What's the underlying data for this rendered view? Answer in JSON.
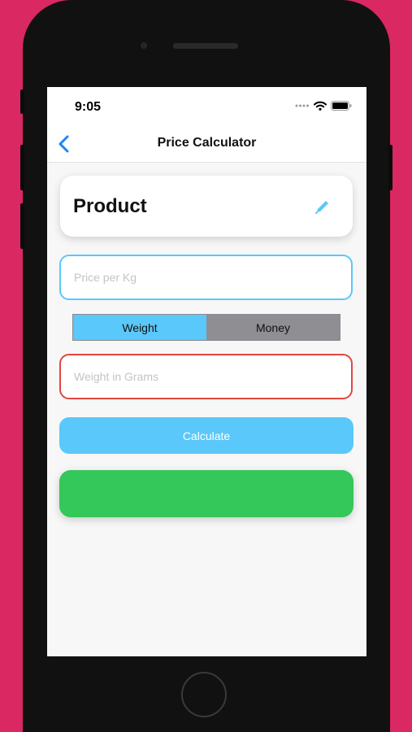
{
  "status_bar": {
    "time": "9:05"
  },
  "nav": {
    "title": "Price Calculator"
  },
  "product_card": {
    "title": "Product"
  },
  "price_field": {
    "value": "",
    "placeholder": "Price per Kg"
  },
  "mode_toggle": {
    "options": [
      "Weight",
      "Money"
    ],
    "selected": "Weight"
  },
  "weight_field": {
    "value": "",
    "placeholder": "Weight in Grams"
  },
  "calculate_button": {
    "label": "Calculate"
  },
  "result": {
    "text": ""
  },
  "colors": {
    "background": "#d92862",
    "accent_blue": "#5ac8fa",
    "error_red": "#e2463f",
    "result_green": "#34c759",
    "segment_inactive": "#8e8e93"
  }
}
